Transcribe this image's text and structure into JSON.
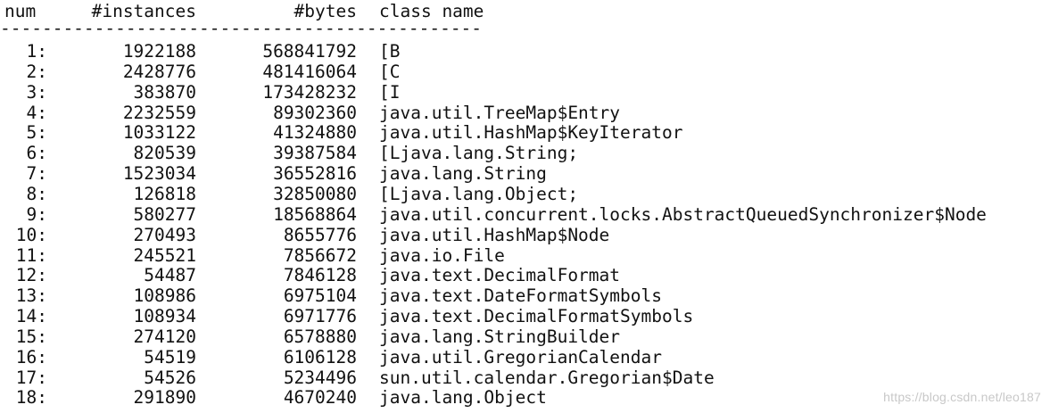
{
  "header": {
    "num": "num",
    "instances": "#instances",
    "bytes": "#bytes",
    "class_name": "class name",
    "separator": "----------------------------------------------"
  },
  "rows": [
    {
      "num": "1:",
      "instances": "1922188",
      "bytes": "568841792",
      "class_name": "[B"
    },
    {
      "num": "2:",
      "instances": "2428776",
      "bytes": "481416064",
      "class_name": "[C"
    },
    {
      "num": "3:",
      "instances": "383870",
      "bytes": "173428232",
      "class_name": "[I"
    },
    {
      "num": "4:",
      "instances": "2232559",
      "bytes": "89302360",
      "class_name": "java.util.TreeMap$Entry"
    },
    {
      "num": "5:",
      "instances": "1033122",
      "bytes": "41324880",
      "class_name": "java.util.HashMap$KeyIterator"
    },
    {
      "num": "6:",
      "instances": "820539",
      "bytes": "39387584",
      "class_name": "[Ljava.lang.String;"
    },
    {
      "num": "7:",
      "instances": "1523034",
      "bytes": "36552816",
      "class_name": "java.lang.String"
    },
    {
      "num": "8:",
      "instances": "126818",
      "bytes": "32850080",
      "class_name": "[Ljava.lang.Object;"
    },
    {
      "num": "9:",
      "instances": "580277",
      "bytes": "18568864",
      "class_name": "java.util.concurrent.locks.AbstractQueuedSynchronizer$Node"
    },
    {
      "num": "10:",
      "instances": "270493",
      "bytes": "8655776",
      "class_name": "java.util.HashMap$Node"
    },
    {
      "num": "11:",
      "instances": "245521",
      "bytes": "7856672",
      "class_name": "java.io.File"
    },
    {
      "num": "12:",
      "instances": "54487",
      "bytes": "7846128",
      "class_name": "java.text.DecimalFormat"
    },
    {
      "num": "13:",
      "instances": "108986",
      "bytes": "6975104",
      "class_name": "java.text.DateFormatSymbols"
    },
    {
      "num": "14:",
      "instances": "108934",
      "bytes": "6971776",
      "class_name": "java.text.DecimalFormatSymbols"
    },
    {
      "num": "15:",
      "instances": "274120",
      "bytes": "6578880",
      "class_name": "java.lang.StringBuilder"
    },
    {
      "num": "16:",
      "instances": "54519",
      "bytes": "6106128",
      "class_name": "java.util.GregorianCalendar"
    },
    {
      "num": "17:",
      "instances": "54526",
      "bytes": "5234496",
      "class_name": "sun.util.calendar.Gregorian$Date"
    },
    {
      "num": "18:",
      "instances": "291890",
      "bytes": "4670240",
      "class_name": "java.lang.Object"
    }
  ],
  "watermark": "https://blog.csdn.net/leo187"
}
